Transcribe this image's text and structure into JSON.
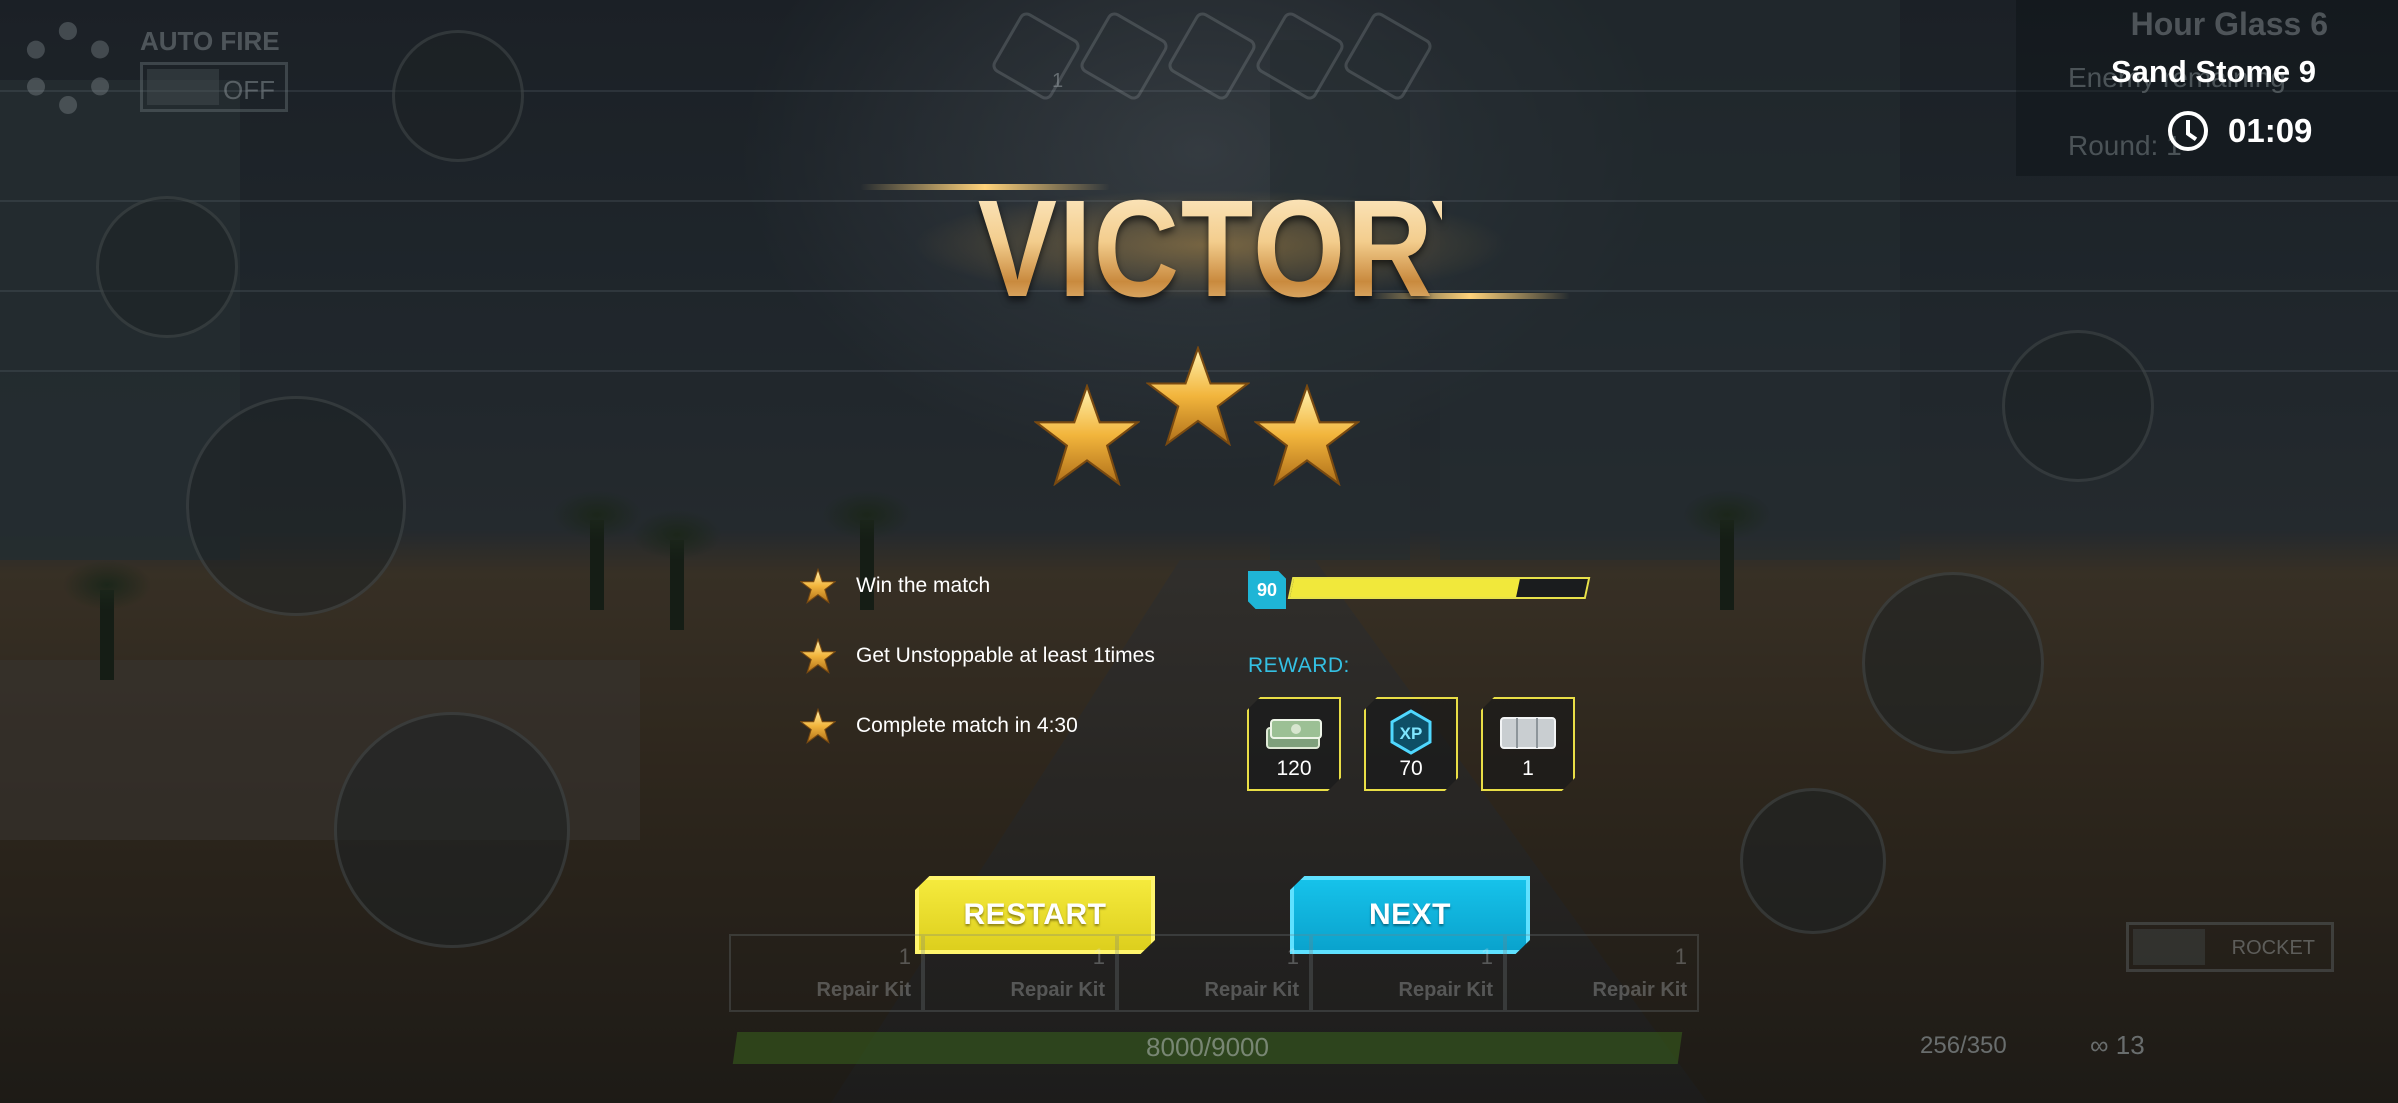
{
  "hud": {
    "autofire_label": "AUTO FIRE",
    "autofire_state": "OFF",
    "top_medal_count": "1",
    "hourglass_ghost": "Hour Glass 6",
    "enemy_ghost": "Enemy remaining",
    "round_ghost": "Round: 1",
    "map_name": "Sand Stome 9",
    "timer": "01:09"
  },
  "result": {
    "title": "VICTORY",
    "stars_earned": 3,
    "stars_total": 3,
    "objectives": [
      {
        "text": "Win the match",
        "achieved": true
      },
      {
        "text": "Get Unstoppable at least 1times",
        "achieved": true
      },
      {
        "text": "Complete match in 4:30",
        "achieved": true
      }
    ],
    "level": "90",
    "xp_progress": 0.77,
    "reward_label": "REWARD:",
    "rewards": [
      {
        "icon": "cash-icon",
        "count": "120"
      },
      {
        "icon": "xp-icon",
        "count": "70"
      },
      {
        "icon": "ammo-box-icon",
        "count": "1"
      }
    ],
    "restart_label": "RESTART",
    "next_label": "NEXT"
  },
  "bottom_hud": {
    "kits": [
      {
        "count": "1",
        "label": "Repair Kit"
      },
      {
        "count": "1",
        "label": "Repair Kit"
      },
      {
        "count": "1",
        "label": "Repair Kit"
      },
      {
        "count": "1",
        "label": "Repair Kit"
      },
      {
        "count": "1",
        "label": "Repair Kit"
      }
    ],
    "health_text": "8000/9000",
    "rocket_label": "ROCKET",
    "ammo_primary": "256/350",
    "ammo_secondary": "∞ 13"
  },
  "colors": {
    "accent_yellow": "#f1e83b",
    "accent_cyan": "#1fb5d6",
    "victory_gold": "#f3cd8d"
  }
}
